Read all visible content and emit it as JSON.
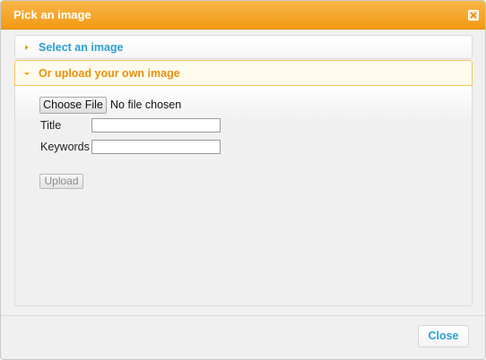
{
  "dialog": {
    "title": "Pick an image",
    "close_icon": "close-x-icon"
  },
  "accordion": {
    "sections": [
      {
        "label": "Select an image",
        "expanded": false,
        "arrow_icon": "triangle-right-icon"
      },
      {
        "label": "Or upload your own image",
        "expanded": true,
        "arrow_icon": "triangle-down-icon"
      }
    ]
  },
  "upload_form": {
    "choose_file_label": "Choose File",
    "file_status": "No file chosen",
    "title_label": "Title",
    "title_value": "",
    "keywords_label": "Keywords",
    "keywords_value": "",
    "upload_label": "Upload"
  },
  "footer": {
    "close_label": "Close"
  },
  "colors": {
    "titlebar_accent": "#f29a12",
    "link_blue": "#2b9fd1",
    "active_orange": "#e8900c"
  }
}
